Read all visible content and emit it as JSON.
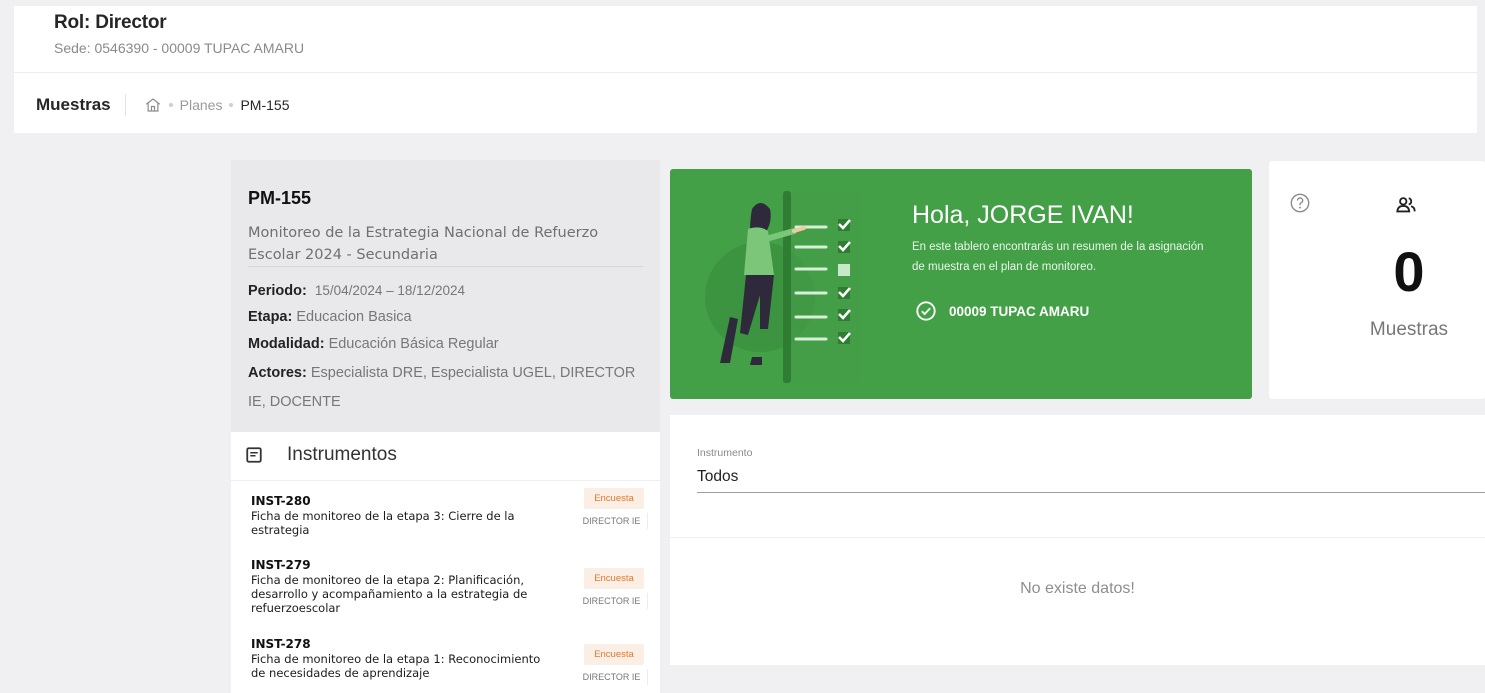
{
  "header": {
    "role": "Rol: Director",
    "sede": "Sede: 0546390 - 00009 TUPAC AMARU"
  },
  "breadcrumb": {
    "title": "Muestras",
    "home_icon": "home-icon",
    "items": [
      "Planes",
      "PM-155"
    ]
  },
  "plan": {
    "code": "PM-155",
    "description": "Monitoreo de la Estrategia Nacional de Refuerzo Escolar 2024 - Secundaria",
    "periodo_label": "Periodo:",
    "periodo_value": "15/04/2024 – 18/12/2024",
    "etapa_label": "Etapa:",
    "etapa_value": "Educacion Basica",
    "modalidad_label": "Modalidad:",
    "modalidad_value": "Educación Básica Regular",
    "actores_label": "Actores:",
    "actores_value": "Especialista DRE, Especialista UGEL, DIRECTOR IE, DOCENTE"
  },
  "instrumentos": {
    "title": "Instrumentos",
    "items": [
      {
        "code": "INST-280",
        "name": "Ficha de monitoreo de la etapa 3: Cierre de la estrategia",
        "tag": "Encuesta",
        "actor": "DIRECTOR IE"
      },
      {
        "code": "INST-279",
        "name": "Ficha de monitoreo de la etapa 2: Planificación, desarrollo y acompañamiento a la estrategia de refuerzoescolar",
        "tag": "Encuesta",
        "actor": "DIRECTOR IE"
      },
      {
        "code": "INST-278",
        "name": "Ficha de monitoreo de la etapa 1: Reconocimiento de necesidades de aprendizaje",
        "tag": "Encuesta",
        "actor": "DIRECTOR IE"
      }
    ]
  },
  "greeting": {
    "title": "Hola, JORGE IVAN!",
    "subtitle": "En este tablero encontrarás un resumen de la asignación de muestra en el plan de monitoreo.",
    "sede": "00009 TUPAC AMARU",
    "bg_color": "#43a047"
  },
  "summary": {
    "count": "0",
    "label": "Muestras"
  },
  "filter": {
    "label": "Instrumento",
    "value": "Todos",
    "empty_message": "No existe datos!"
  }
}
